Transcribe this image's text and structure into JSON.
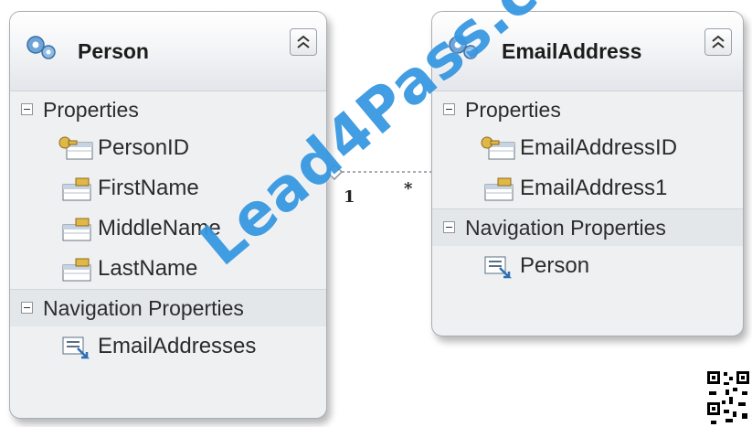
{
  "person": {
    "title": "Person",
    "properties_label": "Properties",
    "properties": [
      "PersonID",
      "FirstName",
      "MiddleName",
      "LastName"
    ],
    "navigation_label": "Navigation Properties",
    "navigation": [
      "EmailAddresses"
    ]
  },
  "email": {
    "title": "EmailAddress",
    "properties_label": "Properties",
    "properties": [
      "EmailAddressID",
      "EmailAddress1"
    ],
    "navigation_label": "Navigation Properties",
    "navigation": [
      "Person"
    ]
  },
  "association": {
    "left_multiplicity": "1",
    "right_multiplicity": "*"
  },
  "watermark": {
    "text": "Lead4Pass.com",
    "color": "#1987dc"
  },
  "icons": {
    "entity": "entity-icon",
    "key_property": "key-property-icon",
    "scalar_property": "scalar-property-icon",
    "navigation_property": "navigation-property-icon",
    "collapse": "collapse-chevron-icon",
    "qr": "qr-code-icon"
  }
}
